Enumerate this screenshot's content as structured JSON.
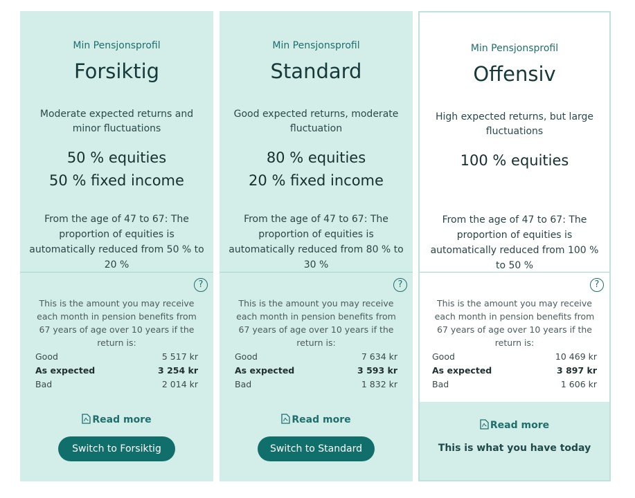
{
  "profiles": [
    {
      "subtitle": "Min Pensjonsprofil",
      "title": "Forsiktig",
      "description": "Moderate expected returns and minor fluctuations",
      "allocation": [
        "50 % equities",
        "50 % fixed income"
      ],
      "glide_path": "From the age of 47 to 67: The proportion of equities is automatically reduced from 50 % to 20 %",
      "help_icon": "question-circle-icon",
      "info_text": "This is the amount you may receive each month in pension benefits from 67 years of age over 10 years if the return is:",
      "scenarios": [
        {
          "label": "Good",
          "value": "5 517 kr"
        },
        {
          "label": "As expected",
          "value": "3 254 kr"
        },
        {
          "label": "Bad",
          "value": "2 014 kr"
        }
      ],
      "read_more": "Read more",
      "read_more_icon": "pdf-icon",
      "action_label": "Switch to Forsiktig"
    },
    {
      "subtitle": "Min Pensjonsprofil",
      "title": "Standard",
      "description": "Good expected returns, moderate fluctuation",
      "allocation": [
        "80 % equities",
        "20 % fixed income"
      ],
      "glide_path": "From the age of 47 to 67: The proportion of equities is automatically reduced from 80 % to 30 %",
      "help_icon": "question-circle-icon",
      "info_text": "This is the amount you may receive each month in pension benefits from 67 years of age over 10 years if the return is:",
      "scenarios": [
        {
          "label": "Good",
          "value": "7 634 kr"
        },
        {
          "label": "As expected",
          "value": "3 593 kr"
        },
        {
          "label": "Bad",
          "value": "1 832 kr"
        }
      ],
      "read_more": "Read more",
      "read_more_icon": "pdf-icon",
      "action_label": "Switch to Standard"
    },
    {
      "subtitle": "Min Pensjonsprofil",
      "title": "Offensiv",
      "description": "High expected returns, but large fluctuations",
      "allocation": [
        "100 % equities"
      ],
      "glide_path": "From the age of 47 to 67: The proportion of equities is automatically reduced from 100 % to 50 %",
      "help_icon": "question-circle-icon",
      "info_text": "This is the amount you may receive each month in pension benefits from 67 years of age over 10 years if the return is:",
      "scenarios": [
        {
          "label": "Good",
          "value": "10 469 kr"
        },
        {
          "label": "As expected",
          "value": "3 897 kr"
        },
        {
          "label": "Bad",
          "value": "1 606 kr"
        }
      ],
      "read_more": "Read more",
      "read_more_icon": "pdf-icon",
      "current_label": "This is what you have today"
    }
  ],
  "colors": {
    "card_bg": "#d3ede8",
    "selected_card_bg": "#ffffff",
    "accent": "#116f6b",
    "button_text": "#ffffff"
  }
}
